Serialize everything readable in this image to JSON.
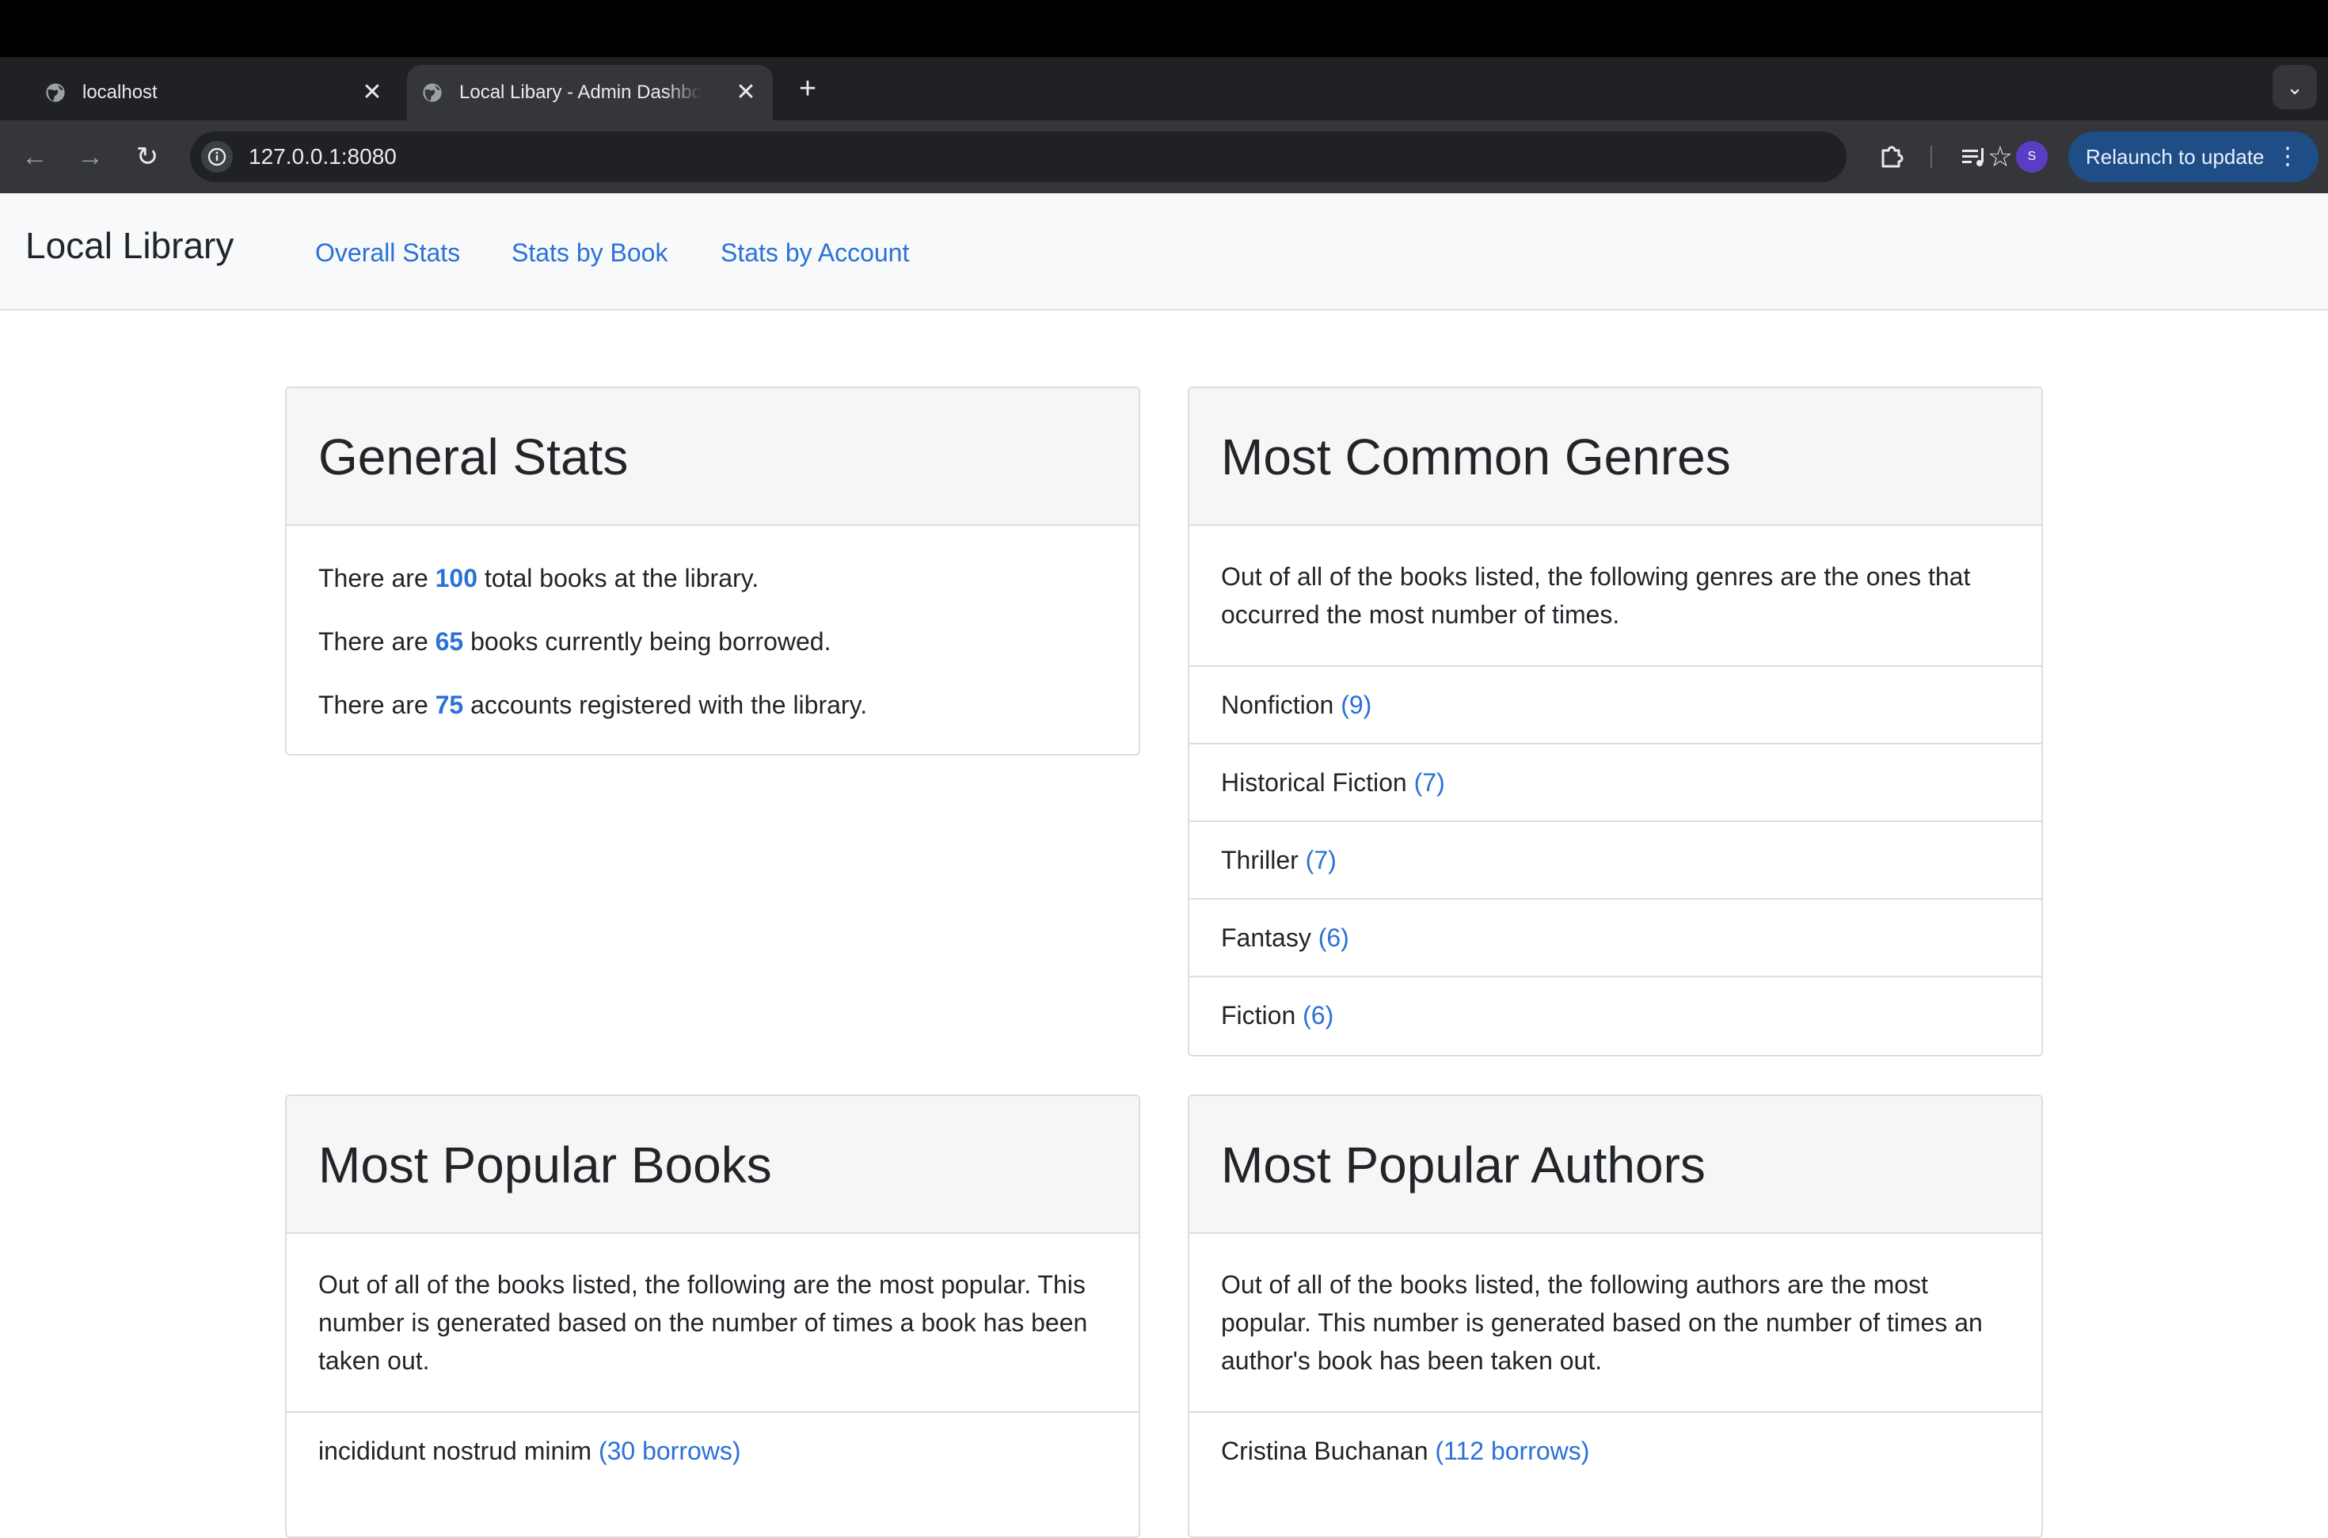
{
  "browser": {
    "tabs": [
      {
        "title": "localhost",
        "active": false
      },
      {
        "title": "Local Libary - Admin Dashboard",
        "active": true
      }
    ],
    "url": "127.0.0.1:8080",
    "profile_initial": "S",
    "relaunch_label": "Relaunch to update"
  },
  "nav": {
    "brand": "Local Library",
    "links": [
      "Overall Stats",
      "Stats by Book",
      "Stats by Account"
    ]
  },
  "general_stats": {
    "title": "General Stats",
    "lines": [
      {
        "prefix": "There are ",
        "value": "100",
        "suffix": " total books at the library."
      },
      {
        "prefix": "There are ",
        "value": "65",
        "suffix": " books currently being borrowed."
      },
      {
        "prefix": "There are ",
        "value": "75",
        "suffix": " accounts registered with the library."
      }
    ]
  },
  "genres": {
    "title": "Most Common Genres",
    "description": "Out of all of the books listed, the following genres are the ones that occurred the most number of times.",
    "items": [
      {
        "name": "Nonfiction",
        "count": "(9)"
      },
      {
        "name": "Historical Fiction",
        "count": "(7)"
      },
      {
        "name": "Thriller",
        "count": "(7)"
      },
      {
        "name": "Fantasy",
        "count": "(6)"
      },
      {
        "name": "Fiction",
        "count": "(6)"
      }
    ]
  },
  "popular_books": {
    "title": "Most Popular Books",
    "description": "Out of all of the books listed, the following are the most popular. This number is generated based on the number of times a book has been taken out.",
    "items": [
      {
        "name": "incididunt nostrud minim",
        "count": "(30 borrows)"
      }
    ]
  },
  "popular_authors": {
    "title": "Most Popular Authors",
    "description": "Out of all of the books listed, the following authors are the most popular. This number is generated based on the number of times an author's book has been taken out.",
    "items": [
      {
        "name": "Cristina Buchanan",
        "count": "(112 borrows)"
      }
    ]
  },
  "colors": {
    "link": "#2b71d6",
    "chrome_dark": "#202124",
    "chrome_toolbar": "#35363a",
    "relaunch": "#1f4d86"
  }
}
